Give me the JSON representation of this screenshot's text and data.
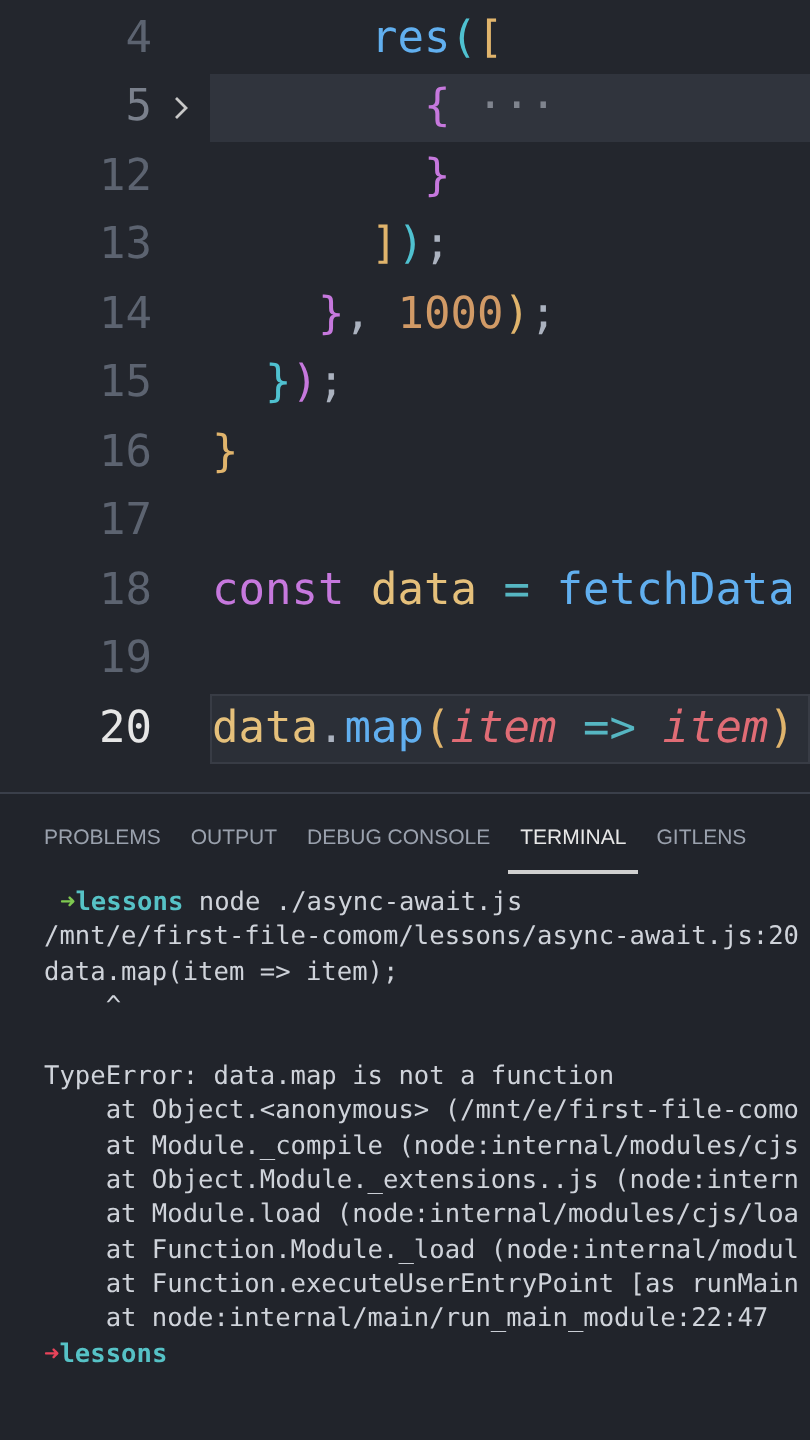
{
  "editor": {
    "lines": [
      {
        "number": "4",
        "current": false,
        "hovered": false,
        "folded": false,
        "tokens": [
          {
            "text": "      res",
            "kind": "function"
          },
          {
            "text": "(",
            "kind": "bracket3"
          },
          {
            "text": "[",
            "kind": "bracket1"
          }
        ]
      },
      {
        "number": "5",
        "current": false,
        "hovered": true,
        "folded": true,
        "tokens": [
          {
            "text": "        {",
            "kind": "bracket2"
          },
          {
            "text": " ···",
            "kind": "fold"
          }
        ]
      },
      {
        "number": "12",
        "current": false,
        "hovered": false,
        "folded": false,
        "tokens": [
          {
            "text": "        }",
            "kind": "bracket2"
          }
        ]
      },
      {
        "number": "13",
        "current": false,
        "hovered": false,
        "folded": false,
        "tokens": [
          {
            "text": "      ]",
            "kind": "bracket1"
          },
          {
            "text": ")",
            "kind": "bracket3"
          },
          {
            "text": ";",
            "kind": "punctuation"
          }
        ]
      },
      {
        "number": "14",
        "current": false,
        "hovered": false,
        "folded": false,
        "tokens": [
          {
            "text": "    }",
            "kind": "bracket2"
          },
          {
            "text": ", ",
            "kind": "punctuation"
          },
          {
            "text": "1000",
            "kind": "number"
          },
          {
            "text": ")",
            "kind": "bracket1"
          },
          {
            "text": ";",
            "kind": "punctuation"
          }
        ]
      },
      {
        "number": "15",
        "current": false,
        "hovered": false,
        "folded": false,
        "tokens": [
          {
            "text": "  }",
            "kind": "bracket3"
          },
          {
            "text": ")",
            "kind": "bracket2"
          },
          {
            "text": ";",
            "kind": "punctuation"
          }
        ]
      },
      {
        "number": "16",
        "current": false,
        "hovered": false,
        "folded": false,
        "tokens": [
          {
            "text": "}",
            "kind": "bracket1"
          }
        ]
      },
      {
        "number": "17",
        "current": false,
        "hovered": false,
        "folded": false
      },
      {
        "number": "18",
        "current": false,
        "hovered": false,
        "folded": false,
        "tokens": [
          {
            "text": "const ",
            "kind": "keyword"
          },
          {
            "text": "data",
            "kind": "variable"
          },
          {
            "text": " = ",
            "kind": "operator"
          },
          {
            "text": "fetchData",
            "kind": "function"
          }
        ]
      },
      {
        "number": "19",
        "current": false,
        "hovered": false,
        "folded": false
      },
      {
        "number": "20",
        "current": true,
        "hovered": false,
        "folded": false,
        "tokens": [
          {
            "text": "data",
            "kind": "variable"
          },
          {
            "text": ".",
            "kind": "punctuation"
          },
          {
            "text": "map",
            "kind": "function"
          },
          {
            "text": "(",
            "kind": "bracket1"
          },
          {
            "text": "item",
            "kind": "parameter"
          },
          {
            "text": " => ",
            "kind": "operator"
          },
          {
            "text": "item",
            "kind": "parameter"
          },
          {
            "text": ")",
            "kind": "bracket1"
          }
        ]
      }
    ]
  },
  "panel_tabs": [
    {
      "label": "PROBLEMS",
      "selected": false
    },
    {
      "label": "OUTPUT",
      "selected": false
    },
    {
      "label": "DEBUG CONSOLE",
      "selected": false
    },
    {
      "label": "TERMINAL",
      "selected": true
    },
    {
      "label": "GITLENS",
      "selected": false
    }
  ],
  "terminal": {
    "lines": [
      {
        "kind": "prompt",
        "color": "#7ec850",
        "arrow": "➜",
        "directory": "lessons",
        "command": "node ./async-await.js"
      },
      {
        "kind": "output",
        "text": "/mnt/e/first-file-comom/lessons/async-await.js:20"
      },
      {
        "kind": "output",
        "text": "data.map(item => item);"
      },
      {
        "kind": "output",
        "text": "    ^"
      },
      {
        "kind": "output",
        "text": "TypeError: data.map is not a function",
        "gap_before": true
      },
      {
        "kind": "output",
        "text": "    at Object.<anonymous> (/mnt/e/first-file-como"
      },
      {
        "kind": "output",
        "text": "    at Module._compile (node:internal/modules/cjs"
      },
      {
        "kind": "output",
        "text": "    at Object.Module._extensions..js (node:intern"
      },
      {
        "kind": "output",
        "text": "    at Module.load (node:internal/modules/cjs/loa"
      },
      {
        "kind": "output",
        "text": "    at Function.Module._load (node:internal/modul"
      },
      {
        "kind": "output",
        "text": "    at Function.executeUserEntryPoint [as runMain"
      },
      {
        "kind": "output",
        "text": "    at node:internal/main/run_main_module:22:47"
      },
      {
        "kind": "prompt",
        "color": "#e8445a",
        "arrow": "➜",
        "directory": "lessons"
      }
    ]
  }
}
